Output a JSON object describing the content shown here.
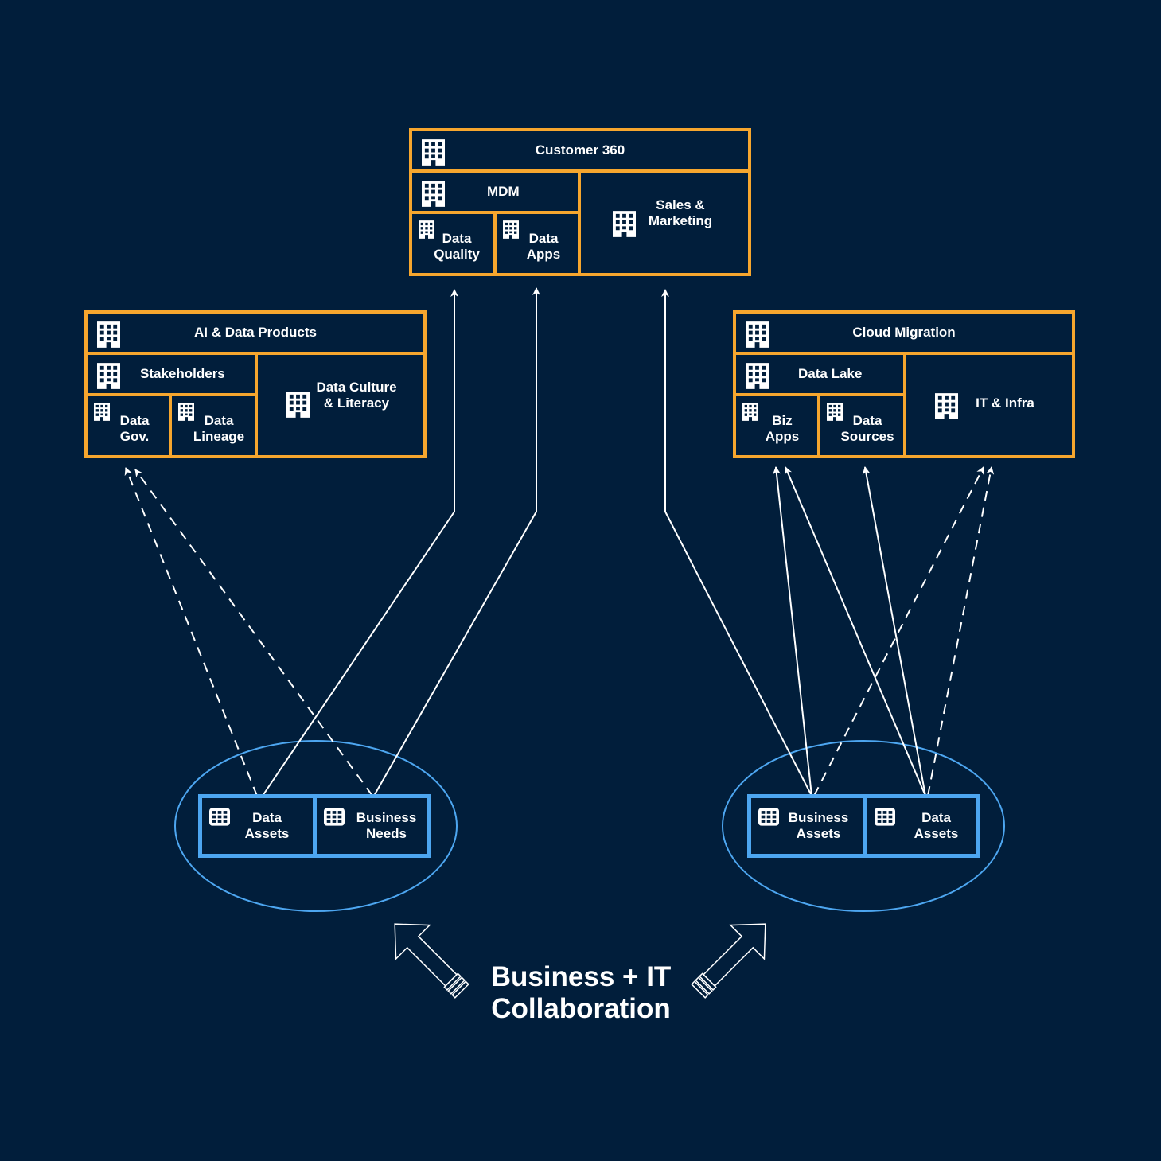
{
  "colors": {
    "background": "#011e3b",
    "orange": "#f6a62e",
    "blue": "#4da6f0",
    "white": "#ffffff"
  },
  "top_group": {
    "title": "Customer 360",
    "sub_header": "MDM",
    "cells": [
      "Data\nQuality",
      "Data\nApps"
    ],
    "side": "Sales &\nMarketing"
  },
  "left_group": {
    "title": "AI & Data Products",
    "sub_header": "Stakeholders",
    "cells": [
      "Data\nGov.",
      "Data\nLineage"
    ],
    "side": "Data Culture\n& Literacy"
  },
  "right_group": {
    "title": "Cloud Migration",
    "sub_header": "Data Lake",
    "cells": [
      "Biz\nApps",
      "Data\nSources"
    ],
    "side": "IT & Infra"
  },
  "left_cluster": {
    "items": [
      "Data\nAssets",
      "Business\nNeeds"
    ]
  },
  "right_cluster": {
    "items": [
      "Business\nAssets",
      "Data\nAssets"
    ]
  },
  "footer": {
    "title": "Business + IT\nCollaboration"
  },
  "icons": {
    "building": "building-icon",
    "grid": "table-grid-icon",
    "arrow": "up-arrow-outline-icon"
  }
}
